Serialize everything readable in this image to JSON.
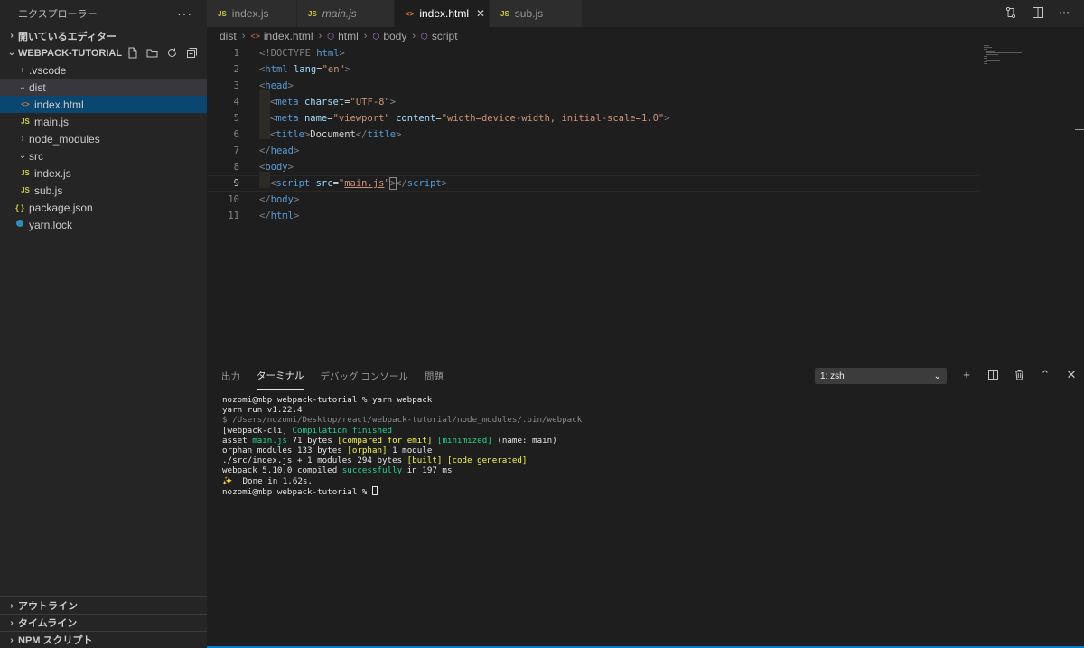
{
  "explorer": {
    "title": "エクスプローラー",
    "more": "···",
    "open_editors": "開いているエディター",
    "project": "WEBPACK-TUTORIAL",
    "tree": [
      {
        "label": ".vscode",
        "kind": "folder",
        "chev": "›"
      },
      {
        "label": "dist",
        "kind": "folder",
        "chev": "⌄"
      },
      {
        "label": "index.html",
        "kind": "html",
        "icon": "<>"
      },
      {
        "label": "main.js",
        "kind": "js",
        "icon": "JS"
      },
      {
        "label": "node_modules",
        "kind": "folder",
        "chev": "›"
      },
      {
        "label": "src",
        "kind": "folder",
        "chev": "⌄"
      },
      {
        "label": "index.js",
        "kind": "js",
        "icon": "JS"
      },
      {
        "label": "sub.js",
        "kind": "js",
        "icon": "JS"
      },
      {
        "label": "package.json",
        "kind": "json",
        "icon": "{ }"
      },
      {
        "label": "yarn.lock",
        "kind": "yarn",
        "icon": "🧶"
      }
    ],
    "outline": "アウトライン",
    "timeline": "タイムライン",
    "npm_scripts": "NPM スクリプト"
  },
  "tabs": [
    {
      "label": "index.js",
      "icon": "JS"
    },
    {
      "label": "main.js",
      "icon": "JS"
    },
    {
      "label": "index.html",
      "icon": "<>",
      "close": "✕"
    },
    {
      "label": "sub.js",
      "icon": "JS"
    }
  ],
  "breadcrumb": {
    "items": [
      "dist",
      "index.html",
      "html",
      "body",
      "script"
    ],
    "sep": "›",
    "html_icon": "<>",
    "cube_icon": "⬡"
  },
  "editor": {
    "line_numbers": [
      "1",
      "2",
      "3",
      "4",
      "5",
      "6",
      "7",
      "8",
      "9",
      "10",
      "11"
    ],
    "l1": {
      "a": "<!DOCTYPE",
      "b": " html",
      "c": ">"
    },
    "l2": {
      "a": "<",
      "b": "html",
      "c": " lang",
      "d": "=",
      "e": "\"en\"",
      "f": ">"
    },
    "l3": {
      "a": "<",
      "b": "head",
      "c": ">"
    },
    "l4": {
      "a": "<",
      "b": "meta",
      "c": " charset",
      "d": "=",
      "e": "\"UTF-8\"",
      "f": ">"
    },
    "l5": {
      "a": "<",
      "b": "meta",
      "c": " name",
      "d": "=",
      "e": "\"viewport\"",
      "f": " content",
      "g": "=",
      "h": "\"width=device-width, initial-scale=1.0\"",
      "i": ">"
    },
    "l6": {
      "a": "<",
      "b": "title",
      "c": ">",
      "d": "Document",
      "e": "</",
      "f": "title",
      "g": ">"
    },
    "l7": {
      "a": "</",
      "b": "head",
      "c": ">"
    },
    "l8": {
      "a": "<",
      "b": "body",
      "c": ">"
    },
    "l9": {
      "a": "<",
      "b": "script",
      "c": " src",
      "d": "=",
      "e": "\"",
      "f": "main.js",
      "g": "\"",
      "h": ">",
      "i": "</",
      "j": "script",
      "k": ">"
    },
    "l10": {
      "a": "</",
      "b": "body",
      "c": ">"
    },
    "l11": {
      "a": "</",
      "b": "html",
      "c": ">"
    }
  },
  "panel": {
    "tabs": [
      "出力",
      "ターミナル",
      "デバッグ コンソール",
      "問題"
    ],
    "terminal_select": "1: zsh",
    "select_chevron": "⌄",
    "actions": {
      "add": "+",
      "split": "◫",
      "trash": "🗑",
      "maximize": "⌃",
      "close": "✕"
    }
  },
  "terminal": {
    "l1": "nozomi@mbp webpack-tutorial % yarn webpack",
    "l2": "yarn run v1.22.4",
    "l3": "$ /Users/nozomi/Desktop/react/webpack-tutorial/node_modules/.bin/webpack",
    "l4a": "[webpack-cli] ",
    "l4b": "Compilation finished",
    "l5a": "asset ",
    "l5b": "main.js",
    "l5c": " 71 bytes ",
    "l5d": "[compared for emit]",
    "l5e": " ",
    "l5f": "[minimized]",
    "l5g": " (name: main)",
    "l6a": "orphan modules 133 bytes ",
    "l6b": "[orphan]",
    "l6c": " 1 module",
    "l7a": "./src/index.js + 1 modules 294 bytes ",
    "l7b": "[built]",
    "l7c": " ",
    "l7d": "[code generated]",
    "l8a": "webpack 5.10.0 compiled ",
    "l8b": "successfully",
    "l8c": " in 197 ms",
    "l9a": "✨",
    "l9b": "  Done in 1.62s.",
    "l10": "nozomi@mbp webpack-tutorial % "
  }
}
